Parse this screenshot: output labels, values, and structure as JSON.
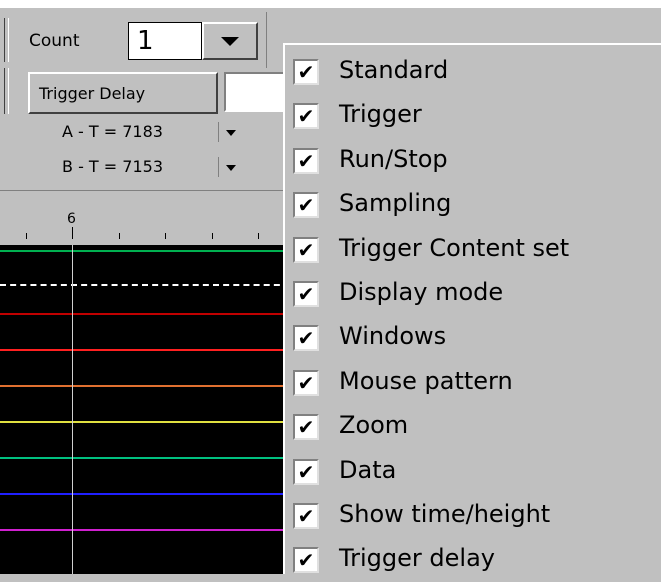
{
  "toolbar": {
    "count_label": "Count",
    "count_value": "1",
    "trigger_delay_label": "Trigger Delay",
    "trigger_delay_value": "",
    "a_t": "A - T = 7183",
    "b_t": "B - T = 7153"
  },
  "ruler": {
    "tick_label": "6"
  },
  "menu": {
    "items": [
      {
        "label": "Standard",
        "checked": true,
        "mark": "✔"
      },
      {
        "label": "Trigger",
        "checked": true,
        "mark": "✔"
      },
      {
        "label": "Run/Stop",
        "checked": true,
        "mark": "✔"
      },
      {
        "label": "Sampling",
        "checked": true,
        "mark": "✔"
      },
      {
        "label": "Trigger  Content set",
        "checked": true,
        "mark": "✔"
      },
      {
        "label": "Display mode",
        "checked": true,
        "mark": "✔"
      },
      {
        "label": "Windows",
        "checked": true,
        "mark": "✔"
      },
      {
        "label": "Mouse pattern",
        "checked": true,
        "mark": "✔"
      },
      {
        "label": "Zoom",
        "checked": true,
        "mark": "✔"
      },
      {
        "label": "Data",
        "checked": true,
        "mark": "✔"
      },
      {
        "label": "Show time/height",
        "checked": true,
        "mark": "✔"
      },
      {
        "label": "Trigger delay",
        "checked": true,
        "mark": "✔"
      }
    ]
  },
  "waveform": {
    "trace_colors": [
      "#00b050",
      "#ffffff",
      "#c00000",
      "#ff2020",
      "#e07030",
      "#e0e040",
      "#00c080",
      "#2020ff",
      "#d020d0"
    ]
  }
}
